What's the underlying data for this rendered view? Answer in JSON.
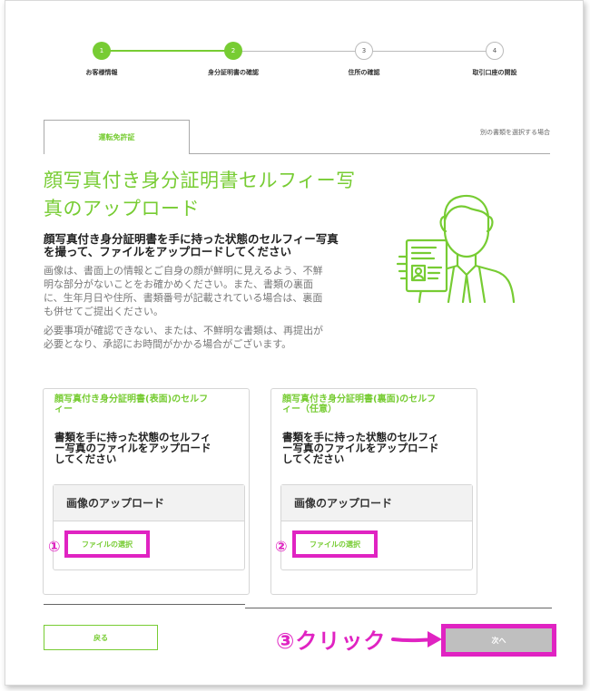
{
  "stepper": {
    "steps": [
      {
        "number": "1",
        "label": "お客様情報",
        "state": "done"
      },
      {
        "number": "2",
        "label": "身分証明書の確認",
        "state": "done"
      },
      {
        "number": "3",
        "label": "住所の確認",
        "state": "todo"
      },
      {
        "number": "4",
        "label": "取引口座の開設",
        "state": "todo"
      }
    ],
    "colors": {
      "done": "#77cc33",
      "todo": "#bbbbbb"
    }
  },
  "tabs": {
    "active_label": "運転免許証",
    "other_link": "別の書類を選択する場合"
  },
  "main": {
    "title_line1": "顔写真付き身分証明書セルフィー写",
    "title_line2": "真のアップロード",
    "subtitle_line1": "顔写真付き身分証明書を手に持った状態のセルフィー写真",
    "subtitle_line2": "を撮って、ファイルをアップロードしてください",
    "desc1_lines": [
      "画像は、書面上の情報とご自身の顔が鮮明に見えるよう、不鮮",
      "明な部分がないことをお確かめください。また、書類の裏面",
      "に、生年月日や住所、書類番号が記載されている場合は、裏面",
      "も併せてご提出ください。"
    ],
    "desc2_lines": [
      "必要事項が確認できない、または、不鮮明な書類は、再提出が",
      "必要となり、承認にお時間がかかる場合がございます。"
    ],
    "illustration_icon": "person-with-id-card-icon"
  },
  "cards": [
    {
      "title_lines": [
        "顔写真付き身分証明書(表面)のセルフ",
        "ィー"
      ],
      "text_lines": [
        "書類を手に持った状態のセルフィ",
        "ー写真のファイルをアップロード",
        "してください"
      ],
      "upload_label": "画像のアップロード",
      "file_button": "ファイルの選択",
      "marker": "①"
    },
    {
      "title_lines": [
        "顔写真付き身分証明書(裏面)のセルフ",
        "ィー（任意）"
      ],
      "text_lines": [
        "書類を手に持った状態のセルフィ",
        "ー写真のファイルをアップロード",
        "してください"
      ],
      "upload_label": "画像のアップロード",
      "file_button": "ファイルの選択",
      "marker": "②"
    }
  ],
  "footer": {
    "back_label": "戻る",
    "next_label": "次へ",
    "annotation": "③クリック"
  },
  "colors": {
    "accent": "#77cc33",
    "highlight": "#e023c2",
    "next_disabled": "#bfbfbf"
  }
}
